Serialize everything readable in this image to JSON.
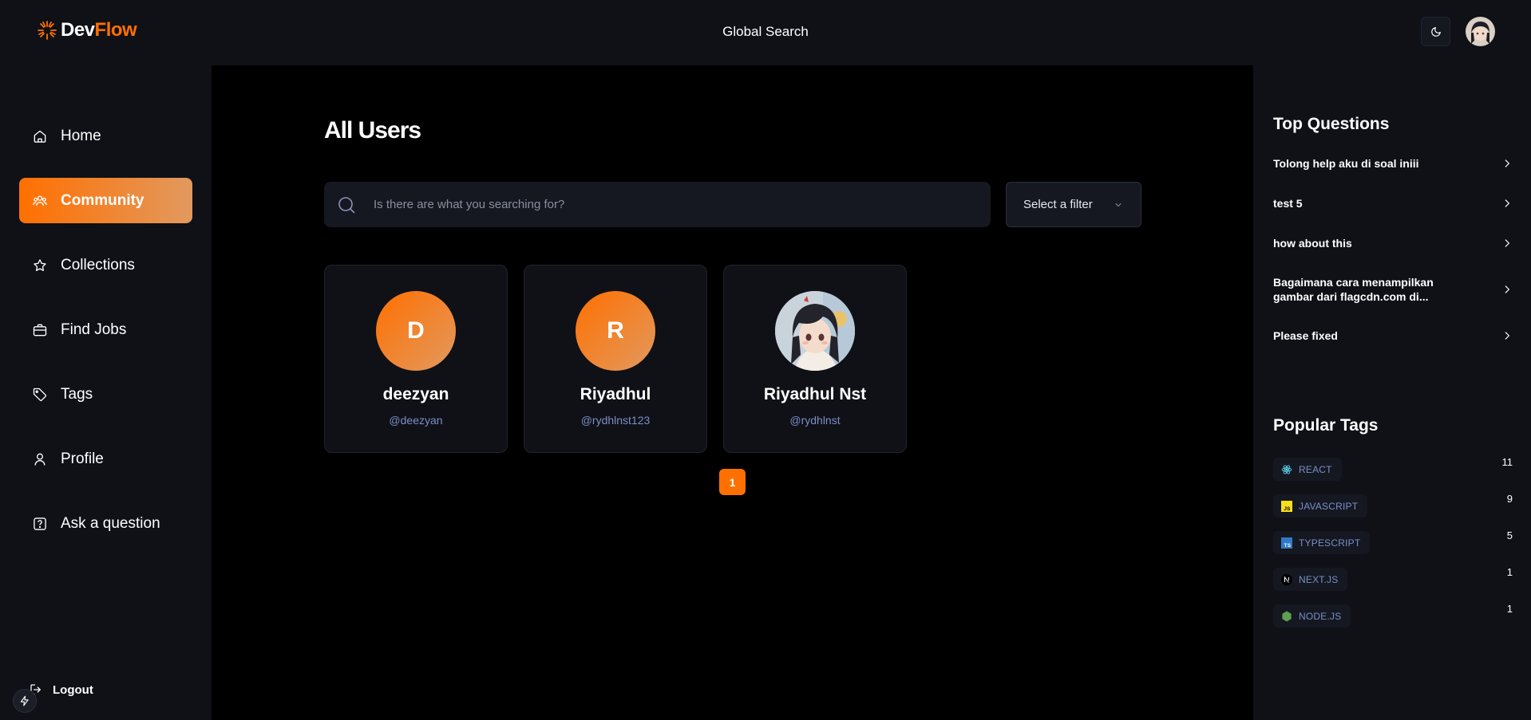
{
  "brand": {
    "part1": "Dev",
    "part2": "Flow",
    "accent": "#ff7000"
  },
  "header": {
    "global_search": "Global Search",
    "theme_icon": "moon-icon"
  },
  "sidebar": {
    "items": [
      {
        "label": "Home",
        "icon": "home-icon"
      },
      {
        "label": "Community",
        "icon": "users-icon",
        "active": true
      },
      {
        "label": "Collections",
        "icon": "star-icon"
      },
      {
        "label": "Find Jobs",
        "icon": "briefcase-icon"
      },
      {
        "label": "Tags",
        "icon": "tag-icon"
      },
      {
        "label": "Profile",
        "icon": "user-icon"
      },
      {
        "label": "Ask a question",
        "icon": "question-icon"
      }
    ],
    "logout": "Logout"
  },
  "main": {
    "title": "All Users",
    "search_placeholder": "Is there are what you searching for?",
    "filter": "Select a filter",
    "users": [
      {
        "initial": "D",
        "name": "deezyan",
        "handle": "@deezyan"
      },
      {
        "initial": "R",
        "name": "Riyadhul",
        "handle": "@rydhlnst123"
      },
      {
        "initial": "",
        "name": "Riyadhul Nst",
        "handle": "@rydhlnst"
      }
    ],
    "page": "1"
  },
  "right": {
    "top_questions_title": "Top Questions",
    "questions": [
      "Tolong help aku di soal iniii",
      "test 5",
      "how about this",
      "Bagaimana cara menampilkan gambar dari flagcdn.com di...",
      "Please fixed"
    ],
    "popular_tags_title": "Popular Tags",
    "tags": [
      {
        "name": "REACT",
        "count": "11",
        "icon": "react-icon",
        "color": "#61dafb"
      },
      {
        "name": "JAVASCRIPT",
        "count": "9",
        "icon": "javascript-icon",
        "color": "#f7df1e"
      },
      {
        "name": "TYPESCRIPT",
        "count": "5",
        "icon": "typescript-icon",
        "color": "#3178c6"
      },
      {
        "name": "NEXT.JS",
        "count": "1",
        "icon": "nextjs-icon",
        "color": "#000000"
      },
      {
        "name": "NODE.JS",
        "count": "1",
        "icon": "nodejs-icon",
        "color": "#5fa04e"
      }
    ]
  }
}
